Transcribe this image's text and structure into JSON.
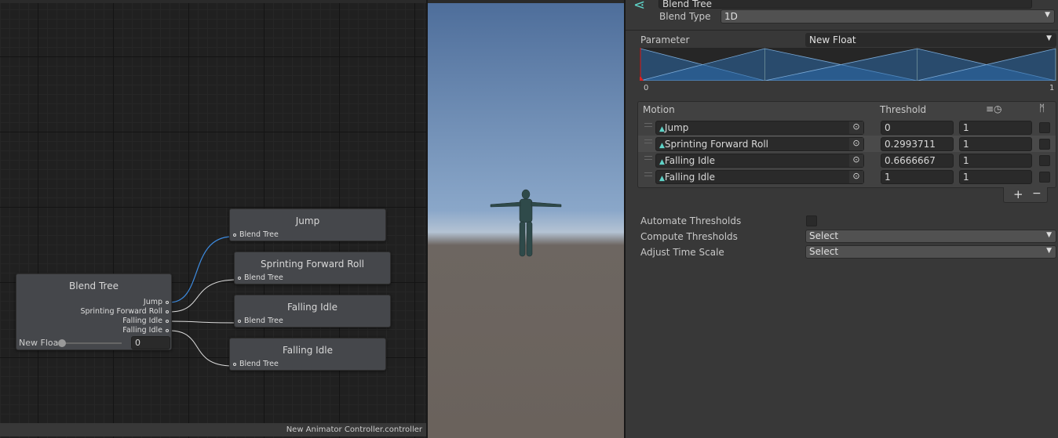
{
  "graph": {
    "blend_tree": {
      "title": "Blend Tree",
      "outputs": [
        "Jump",
        "Sprinting Forward Roll",
        "Falling Idle",
        "Falling Idle"
      ],
      "param_label": "New Floa",
      "param_value": "0"
    },
    "motion_nodes": [
      {
        "title": "Jump",
        "port": "Blend Tree"
      },
      {
        "title": "Sprinting Forward Roll",
        "port": "Blend Tree"
      },
      {
        "title": "Falling Idle",
        "port": "Blend Tree"
      },
      {
        "title": "Falling Idle",
        "port": "Blend Tree"
      }
    ],
    "status": "New Animator Controller.controller"
  },
  "inspector": {
    "name": "Blend Tree",
    "blend_type_label": "Blend Type",
    "blend_type": "1D",
    "parameter_label": "Parameter",
    "parameter": "New Float",
    "range_min": "0",
    "range_max": "1",
    "thresholds_fraction": [
      0,
      0.2993711,
      0.6666667,
      1
    ],
    "headers": {
      "motion": "Motion",
      "threshold": "Threshold",
      "time_scale_icon": "time-scale-icon",
      "mirror_icon": "mirror-icon"
    },
    "rows": [
      {
        "motion": "Jump",
        "threshold": "0",
        "speed": "1",
        "mirror": false
      },
      {
        "motion": "Sprinting Forward Roll",
        "threshold": "0.2993711",
        "speed": "1",
        "mirror": false
      },
      {
        "motion": "Falling Idle",
        "threshold": "0.6666667",
        "speed": "1",
        "mirror": false
      },
      {
        "motion": "Falling Idle",
        "threshold": "1",
        "speed": "1",
        "mirror": false
      }
    ],
    "add": "+",
    "remove": "−",
    "automate_label": "Automate Thresholds",
    "automate": false,
    "compute_label": "Compute Thresholds",
    "compute_value": "Select",
    "adjust_label": "Adjust Time Scale",
    "adjust_value": "Select",
    "accent": "#2b6aa8"
  }
}
